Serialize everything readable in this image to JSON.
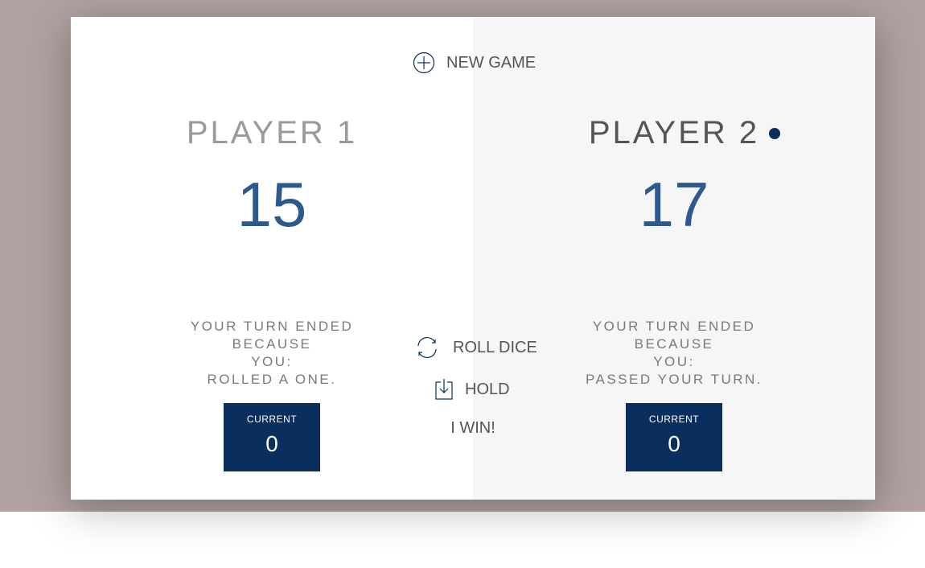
{
  "game": {
    "new_game_label": "NEW GAME",
    "roll_dice_label": "ROLL DICE",
    "hold_label": "HOLD",
    "win_label": "I WIN!"
  },
  "players": [
    {
      "name": "PLAYER 1",
      "score": "15",
      "status_line1": "YOUR TURN ENDED BECAUSE",
      "status_line2": "YOU:",
      "status_line3": "ROLLED A ONE.",
      "current_label": "CURRENT",
      "current_score": "0",
      "active": false
    },
    {
      "name": "PLAYER 2",
      "score": "17",
      "status_line1": "YOUR TURN ENDED BECAUSE",
      "status_line2": "YOU:",
      "status_line3": "PASSED YOUR TURN.",
      "current_label": "CURRENT",
      "current_score": "0",
      "active": true
    }
  ],
  "colors": {
    "backdrop": "#b2a1a1",
    "accent": "#0a2f5c",
    "score": "#2d5a8c",
    "panel_active": "#f6f6f6"
  },
  "icons": {
    "new_game": "plus-circle-icon",
    "roll_dice": "refresh-icon",
    "hold": "download-icon",
    "active_player": "dot-icon"
  }
}
